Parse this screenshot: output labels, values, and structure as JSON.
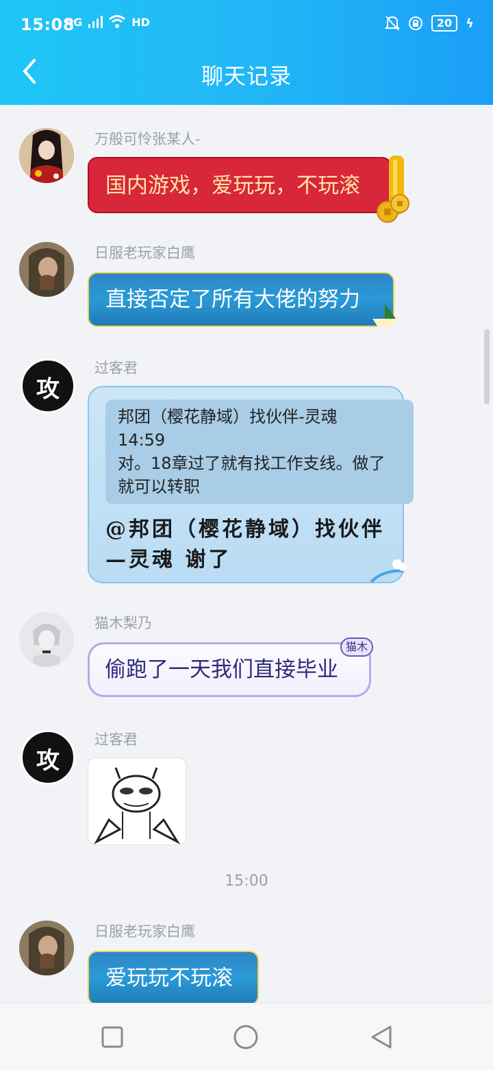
{
  "status_bar": {
    "time": "15:08",
    "network_type": "4G",
    "hd_label": "HD",
    "battery_percent": "20",
    "mute_bell_icon": "bell-off-icon",
    "lock_icon": "lock-circle-icon",
    "charge_icon": "bolt-icon"
  },
  "header": {
    "title": "聊天记录",
    "back_icon": "chevron-left-icon",
    "accent_color": "#22b7f7"
  },
  "messages": [
    {
      "sender": "万般可怜张某人-",
      "text": "国内游戏，爱玩玩，不玩滚",
      "style": "red-envelope"
    },
    {
      "sender": "日服老玩家白鹰",
      "text": "直接否定了所有大佬的努力",
      "style": "blue-ocean"
    },
    {
      "sender": "过客君",
      "avatar_text": "攻",
      "quote": {
        "header": "邦团（樱花静域）找伙伴-灵魂",
        "time": "14:59",
        "text": "对。18章过了就有找工作支线。做了就可以转职"
      },
      "reply_line1": "@邦团（樱花静域）找伙伴",
      "reply_line2": "—灵魂 谢了",
      "style": "light-blue"
    },
    {
      "sender": "猫木梨乃",
      "text": "偷跑了一天我们直接毕业",
      "badge": "猫木",
      "style": "lavender"
    },
    {
      "sender": "过客君",
      "avatar_text": "攻",
      "image": "sticker-devil-sketch",
      "style": "image"
    },
    {
      "sender": "日服老玩家白鹰",
      "text": "爱玩玩不玩滚",
      "style": "blue-ocean"
    }
  ],
  "time_divider": "15:00",
  "nav_bar": {
    "recent_icon": "square-icon",
    "home_icon": "circle-icon",
    "back_icon": "triangle-left-icon"
  }
}
